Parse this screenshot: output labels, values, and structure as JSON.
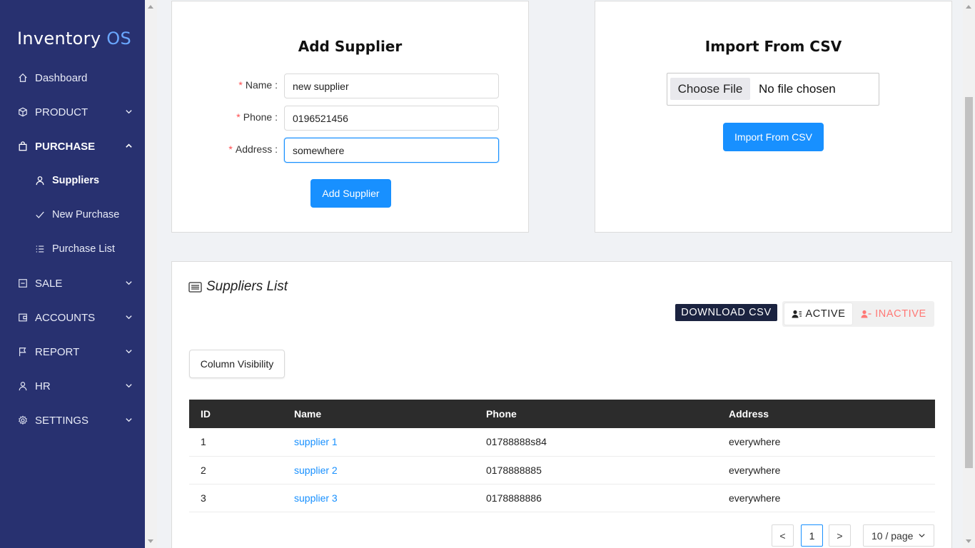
{
  "app": {
    "logo_main": "Inventory",
    "logo_accent": "OS"
  },
  "sidebar": {
    "items": [
      {
        "label": "Dashboard",
        "icon": "home-icon"
      },
      {
        "label": "PRODUCT",
        "icon": "box-icon",
        "expandable": true
      },
      {
        "label": "PURCHASE",
        "icon": "bag-icon",
        "expandable": true,
        "expanded": true
      },
      {
        "label": "Suppliers",
        "icon": "user-icon",
        "sub": true,
        "active": true
      },
      {
        "label": "New Purchase",
        "icon": "check-icon",
        "sub": true
      },
      {
        "label": "Purchase List",
        "icon": "list-icon",
        "sub": true
      },
      {
        "label": "SALE",
        "icon": "minus-square-icon",
        "expandable": true
      },
      {
        "label": "ACCOUNTS",
        "icon": "wallet-icon",
        "expandable": true
      },
      {
        "label": "REPORT",
        "icon": "flag-icon",
        "expandable": true
      },
      {
        "label": "HR",
        "icon": "user-icon",
        "expandable": true
      },
      {
        "label": "SETTINGS",
        "icon": "gear-icon",
        "expandable": true
      }
    ]
  },
  "add_supplier": {
    "title": "Add Supplier",
    "name_label": "Name",
    "phone_label": "Phone",
    "address_label": "Address",
    "name_value": "new supplier",
    "phone_value": "0196521456",
    "address_value": "somewhere",
    "submit_label": "Add Supplier"
  },
  "import_csv": {
    "title": "Import From CSV",
    "choose_file_label": "Choose File",
    "no_file_text": "No file chosen",
    "button_label": "Import From CSV"
  },
  "suppliers_list": {
    "title": "Suppliers List",
    "download_label": "DOWNLOAD CSV",
    "active_label": "ACTIVE",
    "inactive_label": "INACTIVE",
    "column_visibility_label": "Column Visibility",
    "columns": [
      "ID",
      "Name",
      "Phone",
      "Address"
    ],
    "rows": [
      [
        "1",
        "supplier 1",
        "01788888s84",
        "everywhere"
      ],
      [
        "2",
        "supplier 2",
        "0178888885",
        "everywhere"
      ],
      [
        "3",
        "supplier 3",
        "0178888886",
        "everywhere"
      ]
    ]
  },
  "pagination": {
    "prev": "<",
    "current": "1",
    "next": ">",
    "page_size": "10 / page"
  },
  "colors": {
    "sidebar_bg": "#283170",
    "primary": "#1890ff",
    "dark_button": "#1b2340",
    "inactive": "#ff7875",
    "table_header": "#2c2c2c"
  }
}
